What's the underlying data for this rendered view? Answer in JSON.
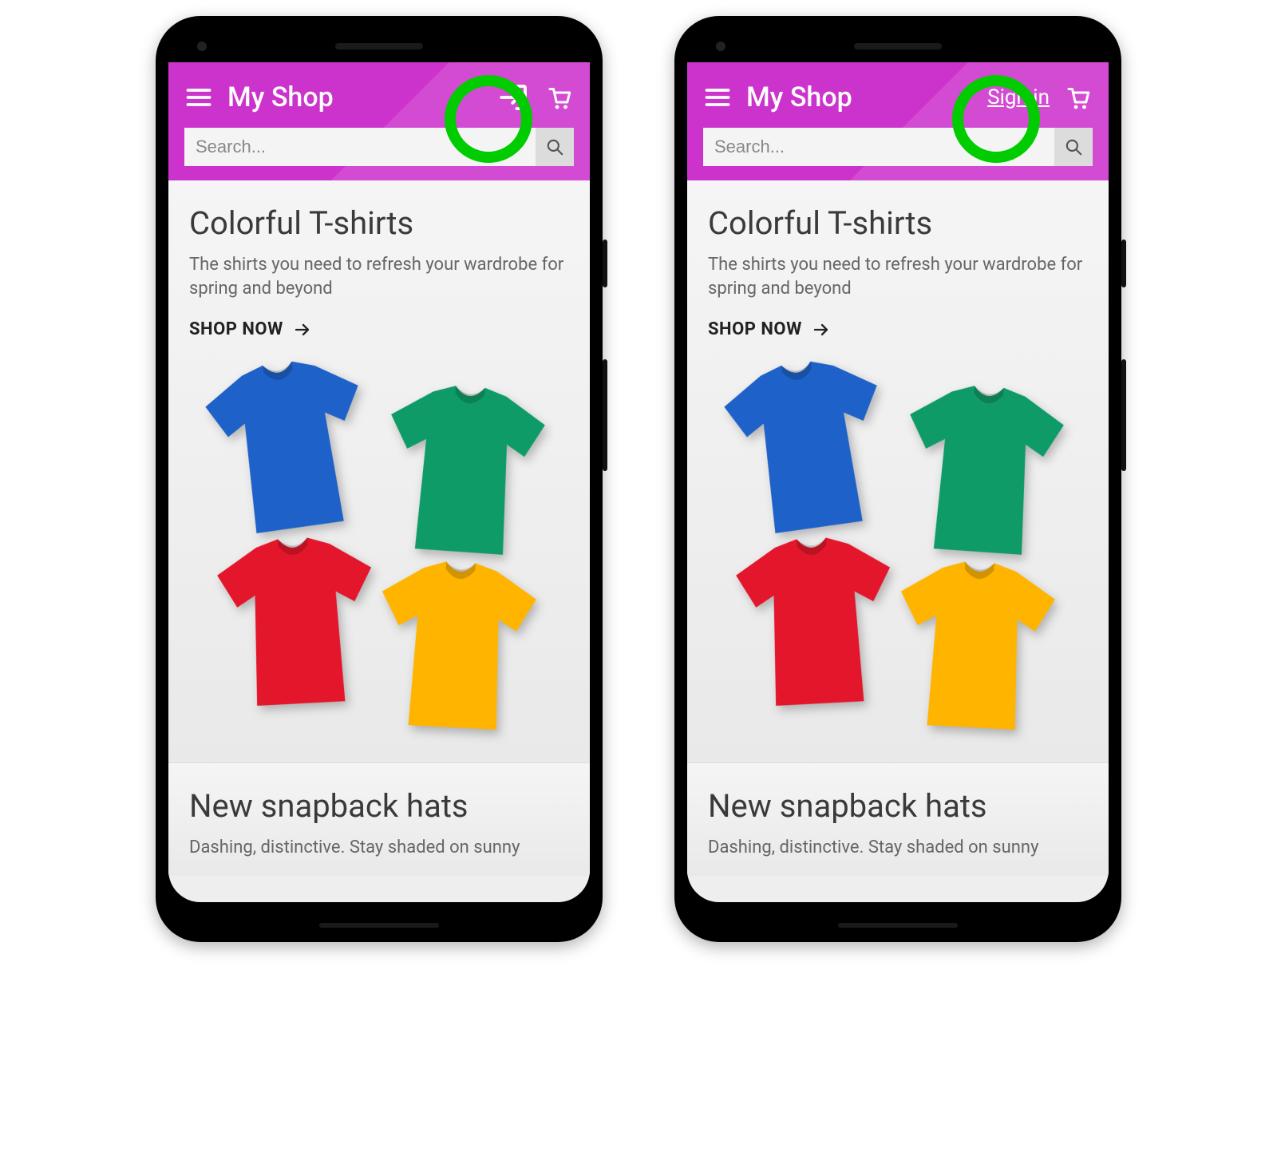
{
  "header": {
    "title": "My Shop",
    "signin_label": "Sign in"
  },
  "search": {
    "placeholder": "Search..."
  },
  "promo1": {
    "title": "Colorful T-shirts",
    "subtitle": "The shirts you need to refresh your wardrobe for spring and beyond",
    "cta": "SHOP NOW"
  },
  "promo2": {
    "title": "New snapback hats",
    "subtitle_partial": "Dashing, distinctive. Stay shaded on sunny"
  },
  "colors": {
    "accent": "#cc33cc",
    "highlight": "#00cc00",
    "tee_blue": "#1e62c9",
    "tee_green": "#0f9b67",
    "tee_red": "#e4162b",
    "tee_yellow": "#ffb400"
  }
}
